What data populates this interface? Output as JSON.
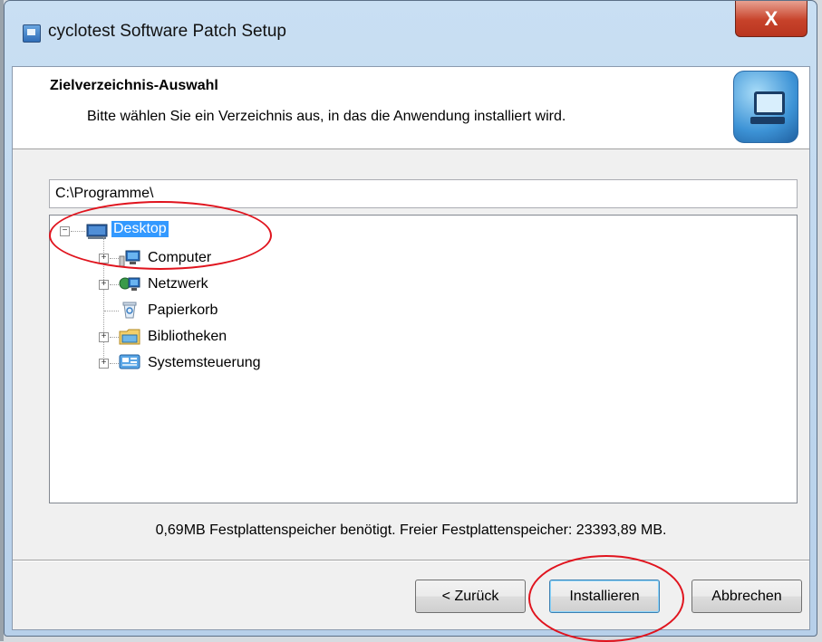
{
  "window": {
    "title": "cyclotest Software Patch Setup",
    "close_label": "X"
  },
  "header": {
    "title": "Zielverzeichnis-Auswahl",
    "subtitle": "Bitte wählen Sie ein Verzeichnis aus, in das die Anwendung installiert wird."
  },
  "path": {
    "value": "C:\\Programme\\"
  },
  "tree": {
    "items": [
      {
        "label": "Desktop",
        "icon": "desktop-icon",
        "expander": "−",
        "selected": true
      },
      {
        "label": "Computer",
        "icon": "computer-icon",
        "expander": "+"
      },
      {
        "label": "Netzwerk",
        "icon": "network-icon",
        "expander": "+"
      },
      {
        "label": "Papierkorb",
        "icon": "recycle-bin-icon",
        "expander": ""
      },
      {
        "label": "Bibliotheken",
        "icon": "libraries-icon",
        "expander": "+"
      },
      {
        "label": "Systemsteuerung",
        "icon": "control-panel-icon",
        "expander": "+"
      }
    ]
  },
  "status": {
    "text": "0,69MB Festplattenspeicher benötigt. Freier Festplattenspeicher: 23393,89 MB."
  },
  "buttons": {
    "back": "< Zurück",
    "install": "Installieren",
    "cancel": "Abbrechen"
  },
  "colors": {
    "selection": "#3399ff",
    "annotation": "#e0141e",
    "close_button": "#c7422a"
  }
}
